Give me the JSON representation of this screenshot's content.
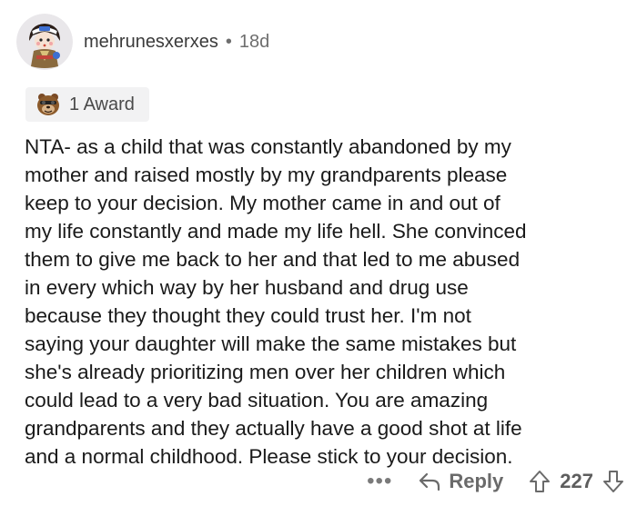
{
  "comment": {
    "username": "mehrunesxerxes",
    "separator": "•",
    "age": "18d",
    "award_label": "1 Award",
    "body_lines": [
      "NTA- as a child that was constantly abandoned by my",
      "mother and raised mostly by my grandparents please",
      "keep to your decision. My mother came in and out of",
      "my life constantly and made my life hell. She convinced",
      "them to give me back to her and that led to me abused",
      "in every which way by her husband and drug use",
      "because they thought they could trust her. I'm not",
      "saying your daughter will make the same mistakes but",
      "she's already prioritizing men over her children which",
      "could lead to a very bad situation. You are amazing",
      "grandparents and they actually have a good shot at life",
      "and a normal childhood. Please stick to your decision."
    ]
  },
  "actions": {
    "more_label": "•••",
    "reply_label": "Reply",
    "score": "227"
  },
  "icons": {
    "avatar": "reddit-avatar",
    "award": "award-icon",
    "reply": "reply-arrow-icon",
    "upvote": "upvote-arrow-icon",
    "downvote": "downvote-arrow-icon"
  },
  "colors": {
    "text": "#1a1a1a",
    "meta": "#6e6e6e",
    "award_bg": "#f2f2f3",
    "icon": "#6a6a6a"
  }
}
